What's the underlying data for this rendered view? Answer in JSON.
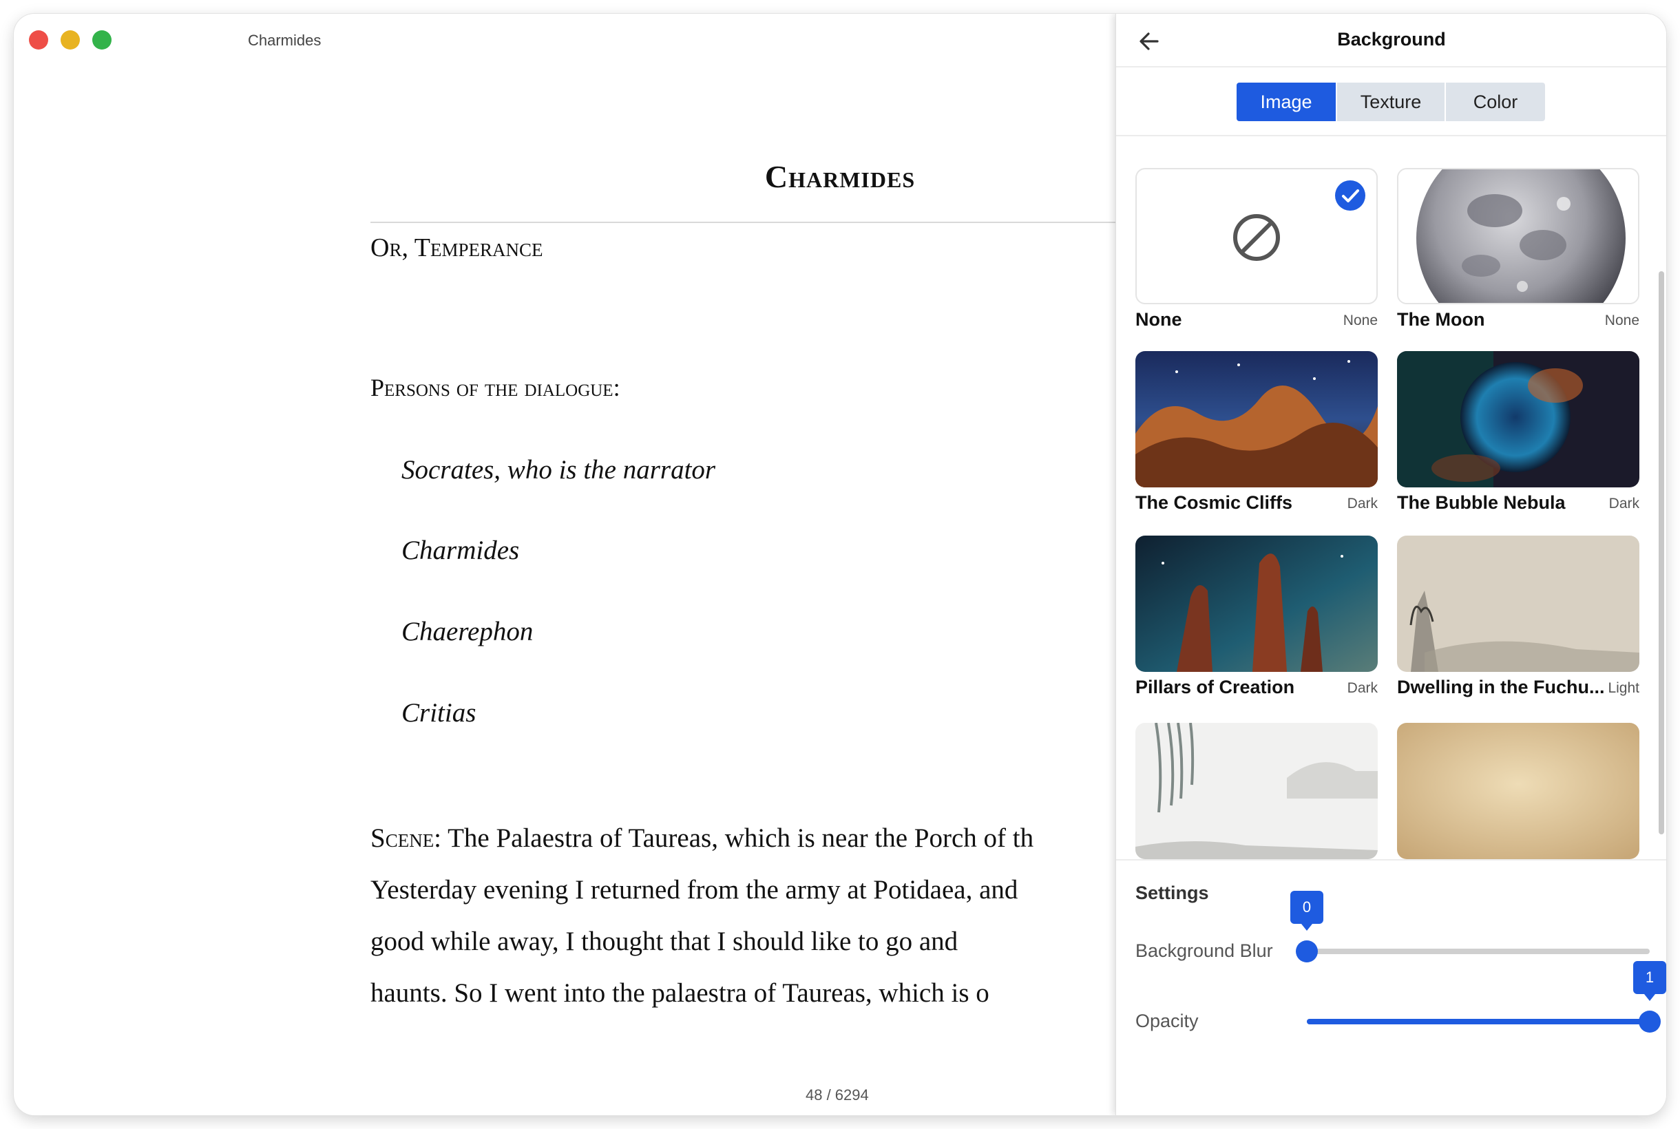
{
  "window": {
    "title": "Charmides"
  },
  "reader": {
    "book_title": "Charmides",
    "subtitle": "Or, Temperance",
    "persons_heading": "Persons of the dialogue:",
    "persons": [
      "Socrates, who is the narrator",
      "Charmides",
      "Chaerephon",
      "Critias"
    ],
    "scene_label": "Scene:",
    "scene_lines": [
      " The Palaestra of Taureas, which is near the Porch of th",
      "Yesterday evening I returned from the army at Potidaea, and",
      "good while away, I thought that I should like to go and",
      "haunts. So I went into the palaestra of Taureas, which is o"
    ],
    "page_counter": "48 / 6294"
  },
  "panel": {
    "title": "Background",
    "back_icon": "arrow-left-icon",
    "tabs": [
      "Image",
      "Texture",
      "Color"
    ],
    "active_tab": "Image",
    "accent_color": "#1e5be0",
    "cards": [
      {
        "name": "None",
        "tag": "None",
        "selected": true
      },
      {
        "name": "The Moon",
        "tag": "None",
        "selected": false
      },
      {
        "name": "The Cosmic Cliffs",
        "tag": "Dark",
        "selected": false
      },
      {
        "name": "The Bubble Nebula",
        "tag": "Dark",
        "selected": false
      },
      {
        "name": "Pillars of Creation",
        "tag": "Dark",
        "selected": false
      },
      {
        "name": "Dwelling in the Fuchu...",
        "tag": "Light",
        "selected": false
      },
      {
        "name": "",
        "tag": "",
        "selected": false
      },
      {
        "name": "",
        "tag": "",
        "selected": false
      }
    ],
    "settings": {
      "title": "Settings",
      "blur": {
        "label": "Background Blur",
        "value": 0,
        "display": "0"
      },
      "opacity": {
        "label": "Opacity",
        "value": 1,
        "display": "1"
      }
    }
  }
}
